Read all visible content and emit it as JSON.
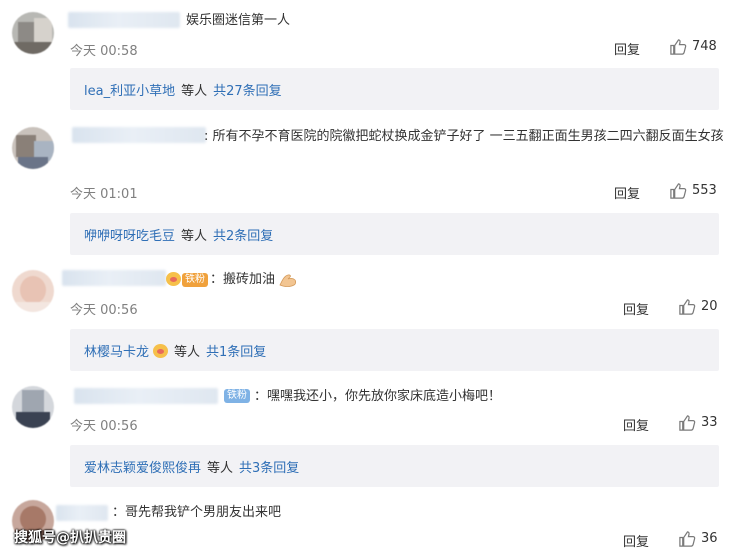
{
  "comments": [
    {
      "text": "娱乐圈迷信第一人",
      "time": "今天 00:58",
      "reply_label": "回复",
      "likes": "748",
      "sub": {
        "name": "lea_利亚小草地",
        "suffix": "等人",
        "total": "共27条回复"
      }
    },
    {
      "text": ":  所有不孕不育医院的院徽把蛇杖换成金铲子好了 一三五翻正面生男孩二四六翻反面生女孩",
      "time": "今天 01:01",
      "reply_label": "回复",
      "likes": "553",
      "sub": {
        "name": "咿咿呀呀吃毛豆",
        "suffix": "等人",
        "total": "共2条回复"
      }
    },
    {
      "badge": "铁粉",
      "text": "：搬砖加油",
      "time": "今天 00:56",
      "reply_label": "回复",
      "likes": "20",
      "sub": {
        "name": "林樱马卡龙",
        "suffix": "等人",
        "total": "共1条回复"
      }
    },
    {
      "badge": "铁粉",
      "text": "：嘿嘿我还小，你先放你家床底造小梅吧！",
      "time": "今天 00:56",
      "reply_label": "回复",
      "likes": "33",
      "sub": {
        "name": "爱林志颖爱俊熙俊再",
        "suffix": "等人",
        "total": "共3条回复"
      }
    },
    {
      "text": "：哥先帮我铲个男朋友出来吧",
      "reply_label": "回复",
      "likes": "36"
    }
  ],
  "watermark": "搜狐号@扒扒贵圈",
  "icons": {
    "like": "thumbs-up-icon",
    "muscle": "flexed-biceps-icon",
    "pig": "pig-face-icon"
  },
  "colors": {
    "link": "#2f6fb6",
    "subbox_bg": "#f2f2f5",
    "time": "#808080"
  }
}
